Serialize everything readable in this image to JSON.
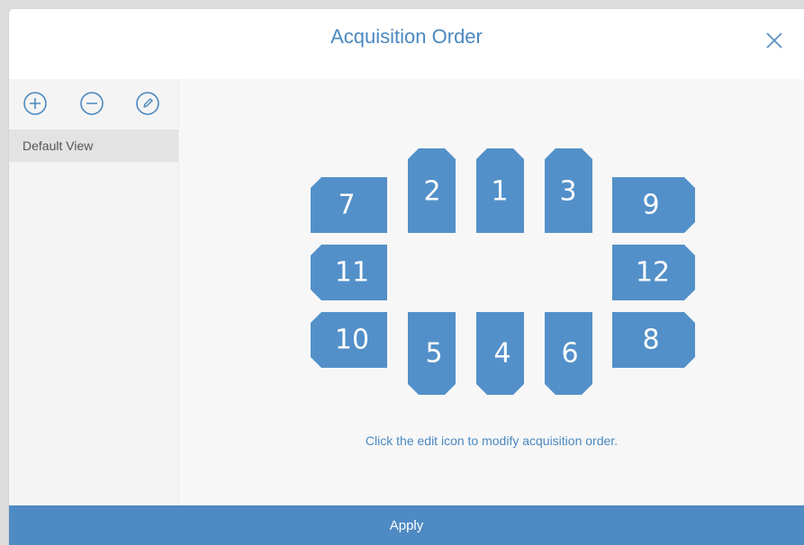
{
  "dialog": {
    "title": "Acquisition Order",
    "close_icon": "close-icon"
  },
  "sidebar": {
    "tools": [
      {
        "icon": "plus-circle-icon"
      },
      {
        "icon": "minus-circle-icon"
      },
      {
        "icon": "edit-circle-icon"
      }
    ],
    "views": [
      {
        "label": "Default View",
        "selected": true
      }
    ]
  },
  "layout": {
    "tile_color": "#5390c9",
    "tiles": [
      {
        "label": "7",
        "shape": "chamfer-left"
      },
      {
        "label": "2",
        "shape": "chamfer-top"
      },
      {
        "label": "1",
        "shape": "chamfer-top"
      },
      {
        "label": "3",
        "shape": "chamfer-top"
      },
      {
        "label": "9",
        "shape": "chamfer-right"
      },
      {
        "label": "11",
        "shape": "chamfer-left"
      },
      {
        "label": "12",
        "shape": "chamfer-right"
      },
      {
        "label": "10",
        "shape": "chamfer-left"
      },
      {
        "label": "5",
        "shape": "chamfer-bottom"
      },
      {
        "label": "4",
        "shape": "chamfer-bottom"
      },
      {
        "label": "6",
        "shape": "chamfer-bottom"
      },
      {
        "label": "8",
        "shape": "chamfer-right"
      }
    ],
    "hint": "Click the edit icon to modify acquisition order."
  },
  "footer": {
    "apply_label": "Apply",
    "color": "#4e8ac3"
  }
}
